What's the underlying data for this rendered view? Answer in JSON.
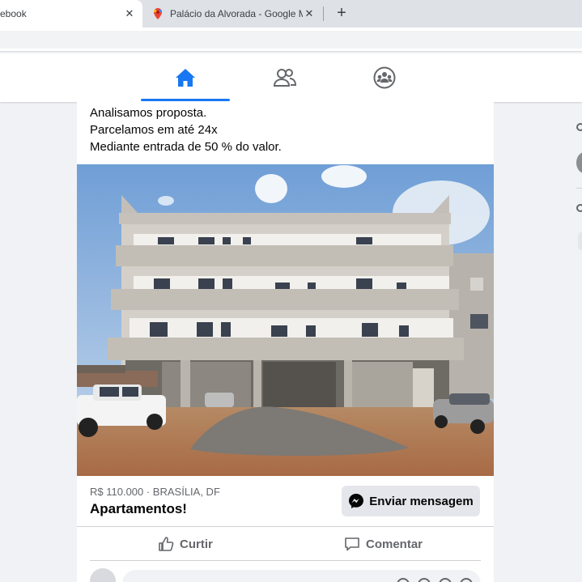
{
  "browser": {
    "tabs": [
      {
        "title": "ebook",
        "close": "✕",
        "active": true
      },
      {
        "title": "Palácio da Alvorada - Google Ma",
        "close": "✕",
        "active": false,
        "icon": "google-maps-icon"
      }
    ],
    "new_tab": "+"
  },
  "facebook_nav": {
    "tabs": [
      {
        "icon": "home-icon",
        "active": true
      },
      {
        "icon": "friends-icon",
        "active": false
      },
      {
        "icon": "groups-icon",
        "active": false
      }
    ],
    "accent": "#1877f2"
  },
  "post": {
    "text_lines": [
      "Analisamos proposta.",
      "Parcelamos em até 24x",
      "Mediante entrada de 50 % do valor."
    ],
    "photo": {
      "icon": "building-photo"
    },
    "marketplace": {
      "price_location": "R$ 110.000 · BRASÍLIA, DF",
      "title": "Apartamentos!",
      "message_button": "Enviar mensagem"
    },
    "actions": {
      "like": "Curtir",
      "comment": "Comentar"
    }
  }
}
